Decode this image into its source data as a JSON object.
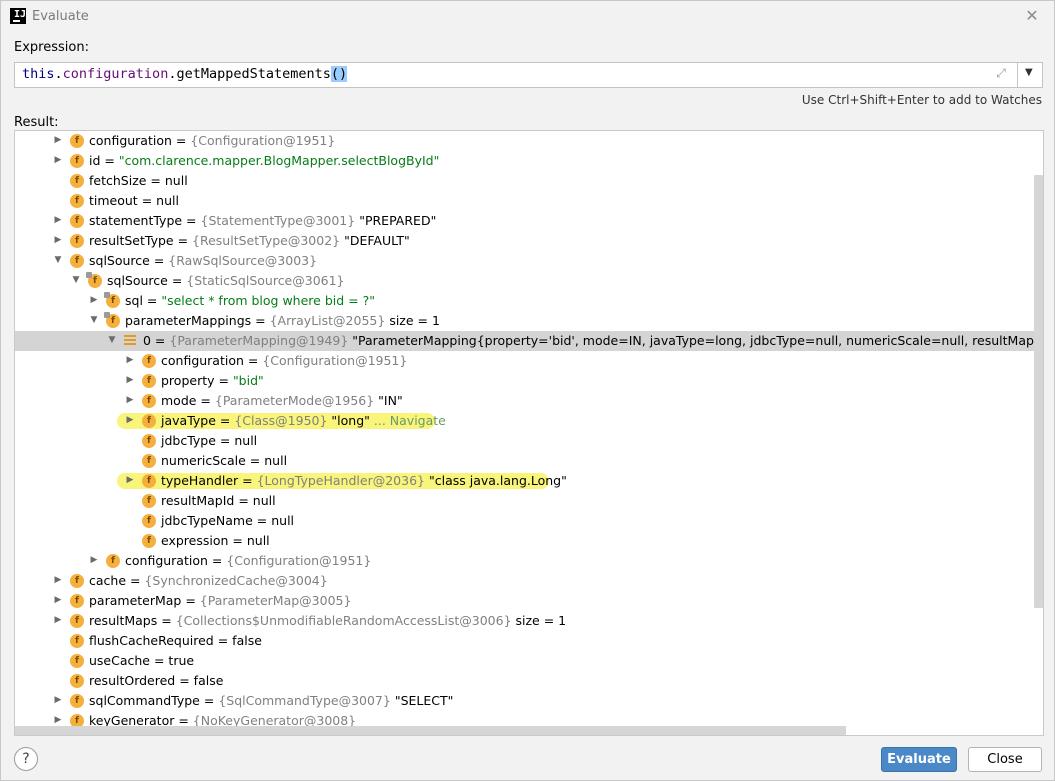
{
  "window": {
    "title": "Evaluate"
  },
  "expression": {
    "label": "Expression:",
    "code": {
      "this": "this",
      "dot1": ".",
      "field": "configuration",
      "dot2": ".",
      "method": "getMappedStatements",
      "parens": "()"
    },
    "hint": "Use Ctrl+Shift+Enter to add to Watches"
  },
  "result": {
    "label": "Result:",
    "rows": [
      {
        "name": "configuration",
        "ref": "{Configuration@1951}",
        "value": ""
      },
      {
        "name": "id",
        "ref": "",
        "value": "\"com.clarence.mapper.BlogMapper.selectBlogById\""
      },
      {
        "name": "fetchSize",
        "ref": "",
        "value": "null"
      },
      {
        "name": "timeout",
        "ref": "",
        "value": "null"
      },
      {
        "name": "statementType",
        "ref": "{StatementType@3001}",
        "value": "\"PREPARED\""
      },
      {
        "name": "resultSetType",
        "ref": "{ResultSetType@3002}",
        "value": "\"DEFAULT\""
      },
      {
        "name": "sqlSource",
        "ref": "{RawSqlSource@3003}",
        "value": ""
      },
      {
        "name": "sqlSource",
        "ref": "{StaticSqlSource@3061}",
        "value": ""
      },
      {
        "name": "sql",
        "ref": "",
        "value": "\"select * from blog where bid = ?\""
      },
      {
        "name": "parameterMappings",
        "ref": "{ArrayList@2055}",
        "value": " size = 1"
      },
      {
        "name": "0",
        "ref": "{ParameterMapping@1949}",
        "value": "\"ParameterMapping{property='bid', mode=IN, javaType=long, jdbcType=null, numericScale=null, resultMapId='null', jdbc"
      },
      {
        "name": "configuration",
        "ref": "{Configuration@1951}",
        "value": ""
      },
      {
        "name": "property",
        "ref": "",
        "value": "\"bid\""
      },
      {
        "name": "mode",
        "ref": "{ParameterMode@1956}",
        "value": "\"IN\""
      },
      {
        "name": "javaType",
        "ref": "{Class@1950}",
        "value": "\"long\"",
        "extra": "... Navigate"
      },
      {
        "name": "jdbcType",
        "ref": "",
        "value": "null"
      },
      {
        "name": "numericScale",
        "ref": "",
        "value": "null"
      },
      {
        "name": "typeHandler",
        "ref": "{LongTypeHandler@2036}",
        "value": "\"class java.lang.Long\""
      },
      {
        "name": "resultMapId",
        "ref": "",
        "value": "null"
      },
      {
        "name": "jdbcTypeName",
        "ref": "",
        "value": "null"
      },
      {
        "name": "expression",
        "ref": "",
        "value": "null"
      },
      {
        "name": "configuration",
        "ref": "{Configuration@1951}",
        "value": ""
      },
      {
        "name": "cache",
        "ref": "{SynchronizedCache@3004}",
        "value": ""
      },
      {
        "name": "parameterMap",
        "ref": "{ParameterMap@3005}",
        "value": ""
      },
      {
        "name": "resultMaps",
        "ref": "{Collections$UnmodifiableRandomAccessList@3006}",
        "value": " size = 1"
      },
      {
        "name": "flushCacheRequired",
        "ref": "",
        "value": "false"
      },
      {
        "name": "useCache",
        "ref": "",
        "value": "true"
      },
      {
        "name": "resultOrdered",
        "ref": "",
        "value": "false"
      },
      {
        "name": "sqlCommandType",
        "ref": "{SqlCommandType@3007}",
        "value": "\"SELECT\""
      },
      {
        "name": "keyGenerator",
        "ref": "{NoKeyGenerator@3008}",
        "value": ""
      }
    ]
  },
  "footer": {
    "help": "?",
    "evaluate": "Evaluate",
    "close": "Close"
  },
  "colors": {
    "accent": "#4a88c7",
    "string": "#067d17",
    "highlight": "#f8f57a",
    "field_icon": "#f4af3d"
  }
}
